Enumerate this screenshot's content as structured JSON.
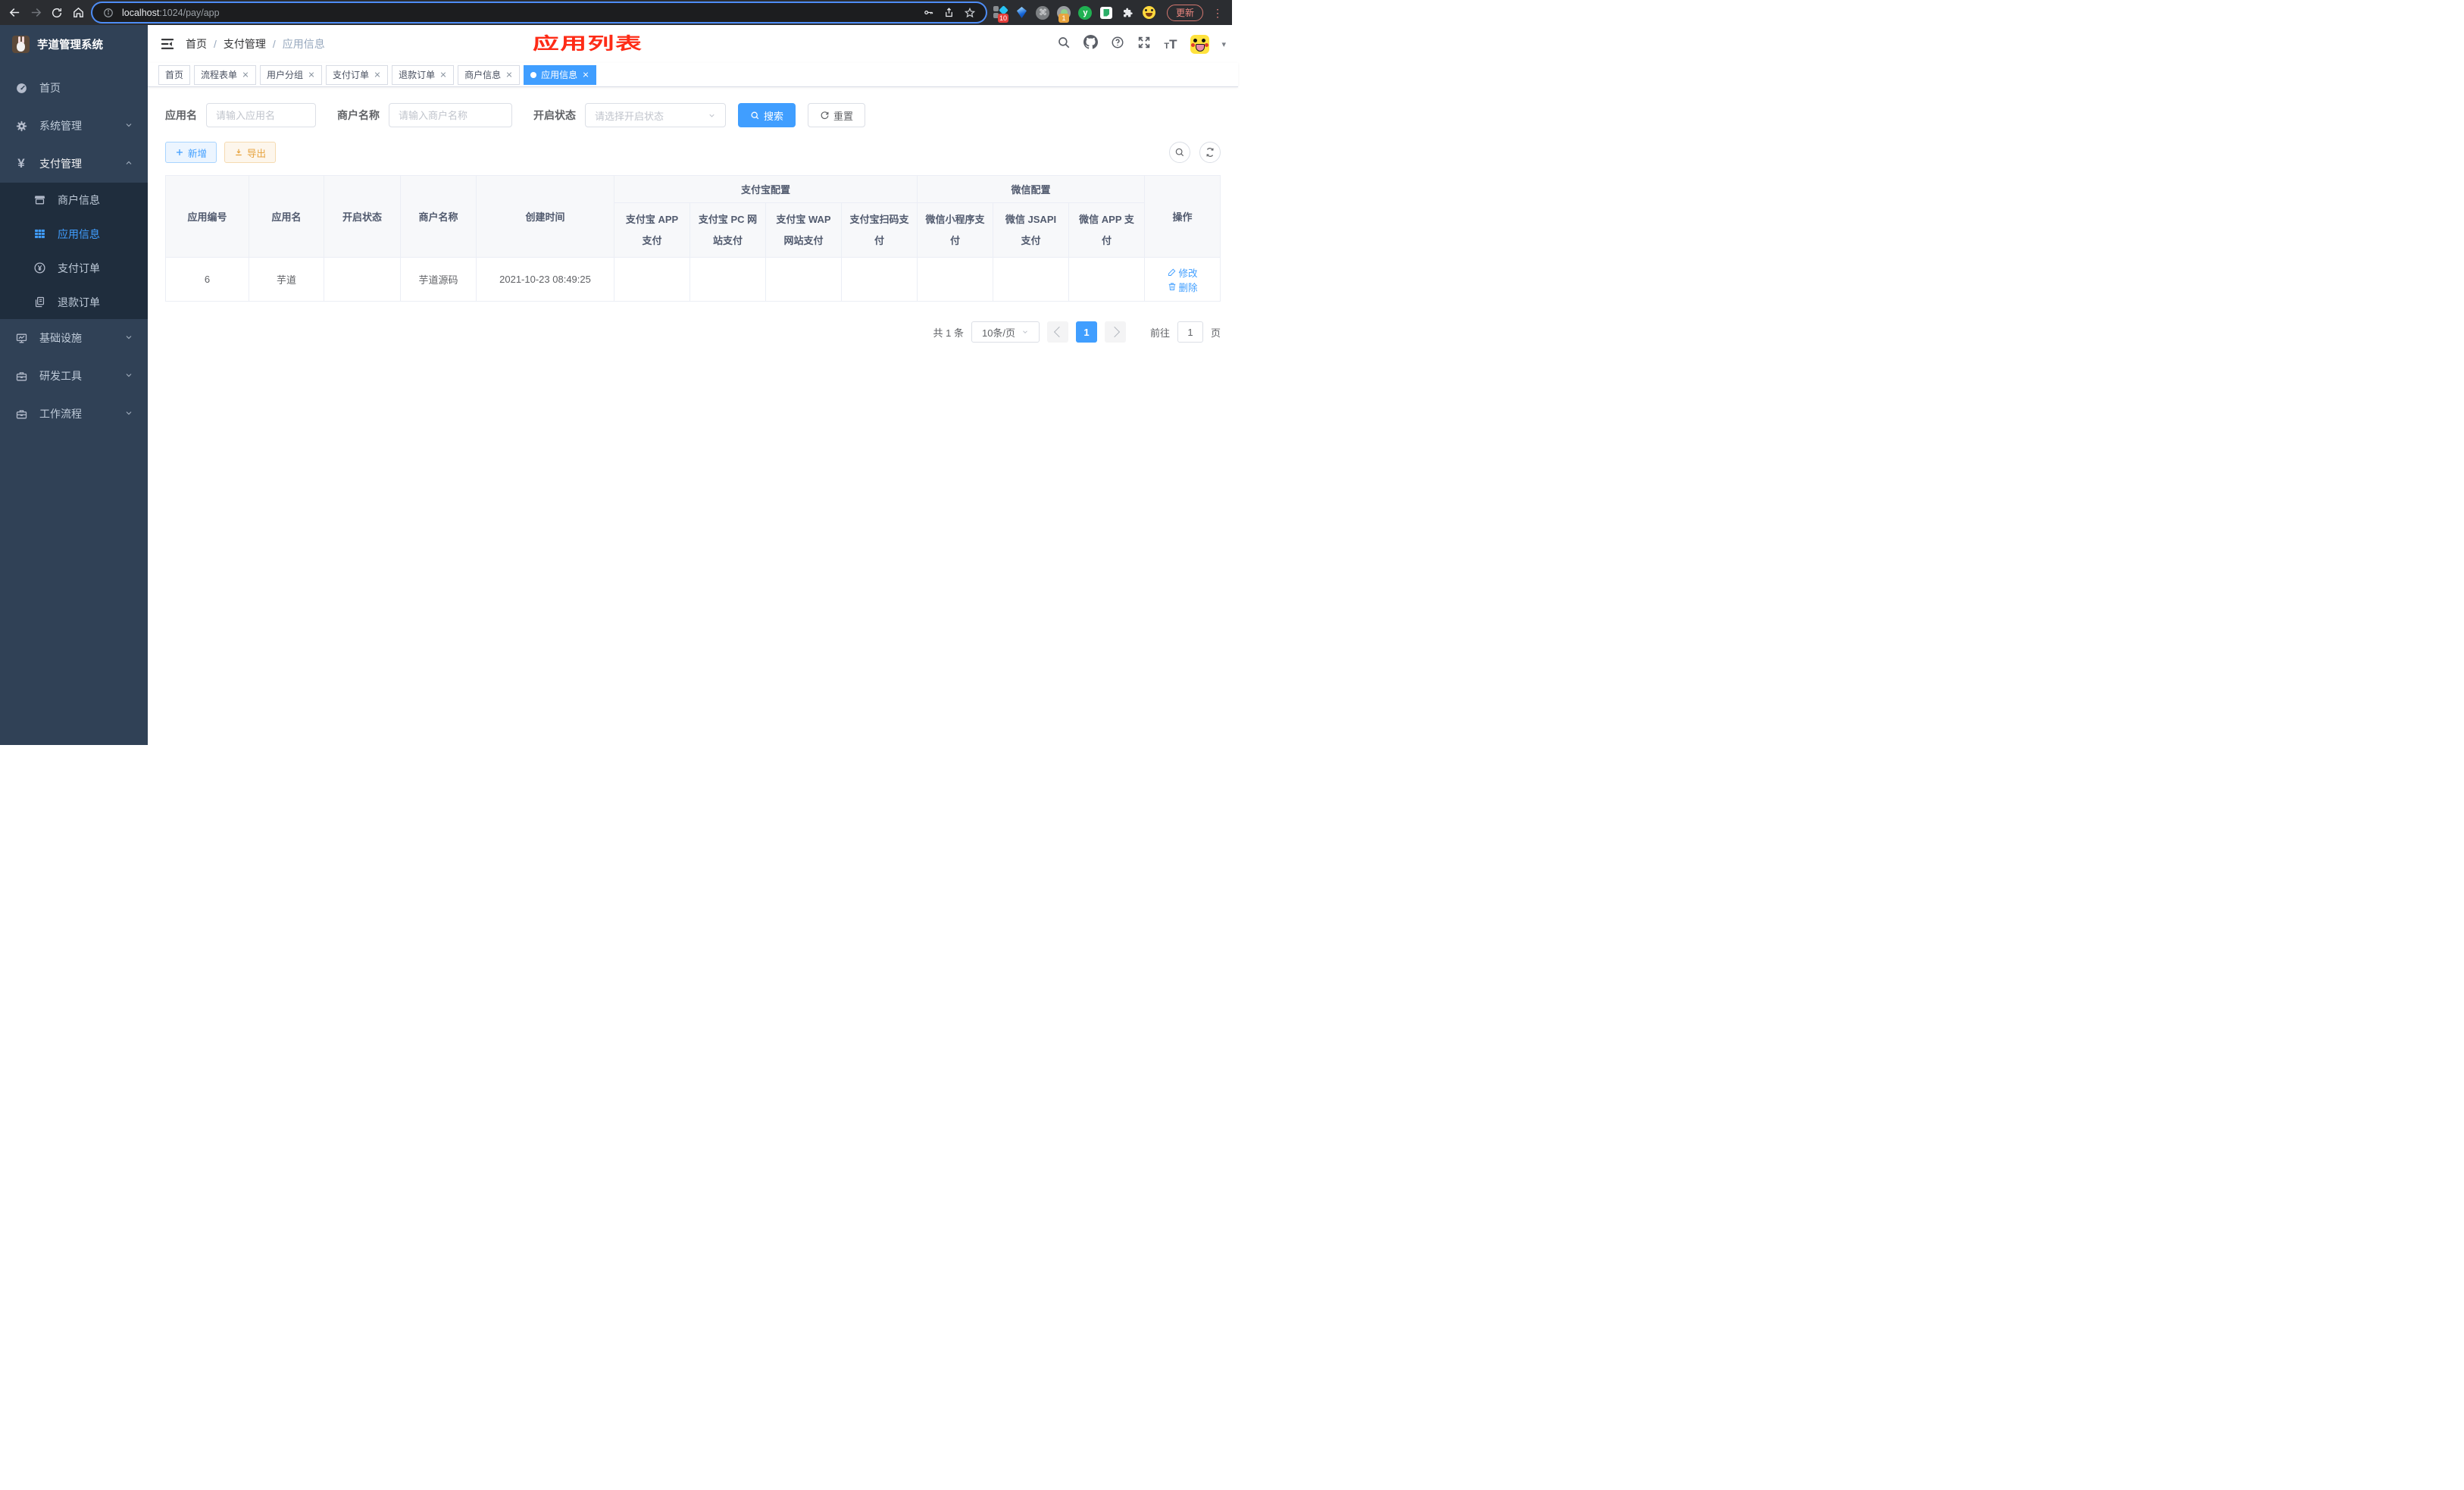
{
  "browser": {
    "url_host": "localhost",
    "url_rest": ":1024/pay/app",
    "update_label": "更新",
    "ext_badge_count": "10",
    "ext_camera_badge": "1"
  },
  "icons": {
    "command_glyph": "⌘",
    "y_glyph": "y",
    "ellipsis_glyph": "⋮",
    "caret_glyph": "▾",
    "text_small": "T",
    "text_large": "T",
    "yen_glyph": "¥"
  },
  "sidebar": {
    "title": "芋道管理系统",
    "menu": [
      {
        "label": "首页"
      },
      {
        "label": "系统管理"
      },
      {
        "label": "支付管理"
      }
    ],
    "submenu": [
      {
        "label": "商户信息"
      },
      {
        "label": "应用信息"
      },
      {
        "label": "支付订单"
      },
      {
        "label": "退款订单"
      }
    ],
    "menu2": [
      {
        "label": "基础设施"
      },
      {
        "label": "研发工具"
      },
      {
        "label": "工作流程"
      }
    ]
  },
  "navbar": {
    "breadcrumb": [
      "首页",
      "支付管理",
      "应用信息"
    ],
    "separator": "/",
    "annotation": "应用列表"
  },
  "tags": [
    {
      "label": "首页"
    },
    {
      "label": "流程表单"
    },
    {
      "label": "用户分组"
    },
    {
      "label": "支付订单"
    },
    {
      "label": "退款订单"
    },
    {
      "label": "商户信息"
    },
    {
      "label": "应用信息"
    }
  ],
  "filters": {
    "app_name_label": "应用名",
    "app_name_placeholder": "请输入应用名",
    "merchant_label": "商户名称",
    "merchant_placeholder": "请输入商户名称",
    "status_label": "开启状态",
    "status_placeholder": "请选择开启状态",
    "search_label": "搜索",
    "reset_label": "重置"
  },
  "toolbar": {
    "add_label": "新增",
    "export_label": "导出"
  },
  "table": {
    "headers": {
      "app_id": "应用编号",
      "app_name": "应用名",
      "open_status": "开启状态",
      "merchant_name": "商户名称",
      "create_time": "创建时间",
      "alipay_group": "支付宝配置",
      "wechat_group": "微信配置",
      "actions": "操作",
      "channels": [
        "支付宝 APP 支付",
        "支付宝 PC 网站支付",
        "支付宝 WAP 网站支付",
        "支付宝扫码支付",
        "微信小程序支付",
        "微信 JSAPI 支付",
        "微信 APP 支付"
      ]
    },
    "rows": [
      {
        "app_id": "6",
        "app_name": "芋道",
        "open_status": "on",
        "merchant_name": "芋道源码",
        "create_time": "2021-10-23 08:49:25",
        "channels": [
          "no",
          "no",
          "no",
          "no",
          "no",
          "yes",
          "no"
        ],
        "edit_label": "修改",
        "delete_label": "删除"
      }
    ]
  },
  "pagination": {
    "total": "共 1 条",
    "page_size": "10条/页",
    "current_page": "1",
    "goto_label": "前往",
    "goto_value": "1",
    "page_label": "页"
  },
  "colors": {
    "accent": "#409eff",
    "success": "#13ce66",
    "danger": "#ff4949",
    "warning": "#e6a23c",
    "sidebar_bg": "#304156",
    "submenu_bg": "#1f2d3d",
    "annotation_red": "#fe2b16"
  }
}
